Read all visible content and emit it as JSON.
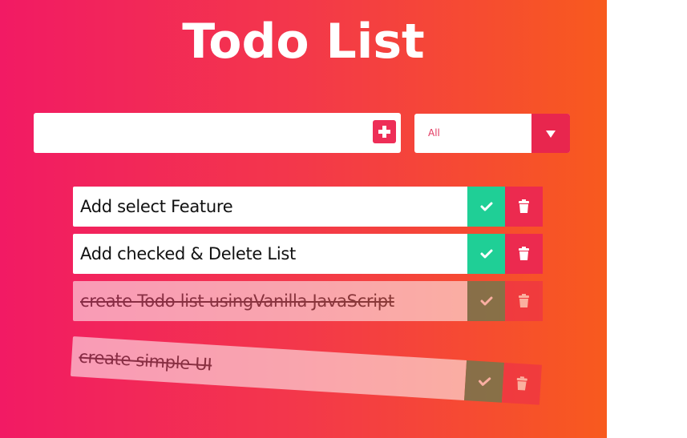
{
  "app": {
    "title": "Todo List"
  },
  "form": {
    "input_value": "",
    "add_icon": "plus-icon",
    "filter_selected": "All"
  },
  "todos": [
    {
      "text": "Add select Feature",
      "completed": false
    },
    {
      "text": "Add checked & Delete List",
      "completed": false
    },
    {
      "text": "create Todo list usingVanilla JavaScript",
      "completed": true
    },
    {
      "text": "create simple UI",
      "completed": true
    }
  ],
  "icons": {
    "check": "check-icon",
    "trash": "trash-icon"
  },
  "colors": {
    "gradient_start": "#f21a64",
    "gradient_end": "#f85a1e",
    "check": "#1fcf96",
    "trash": "#ec2a4f"
  }
}
